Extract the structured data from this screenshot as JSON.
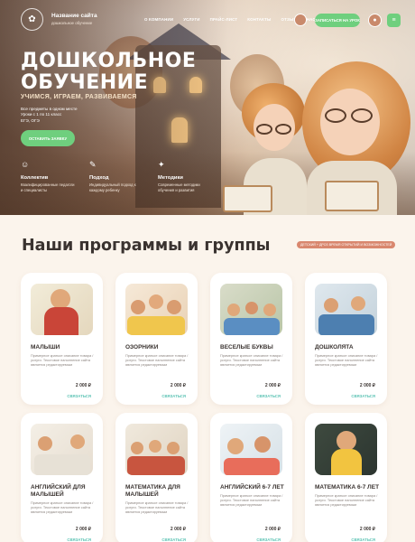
{
  "header": {
    "site_name": "Название сайта",
    "site_sub": "дошкольное обучение",
    "nav": [
      "О КОМПАНИИ",
      "УСЛУГИ",
      "ПРАЙС-ЛИСТ",
      "КОНТАКТЫ",
      "ОТЗЫВЫ О НАС"
    ],
    "contact_button": "ЗАПИСАТЬСЯ НА УРОК"
  },
  "hero": {
    "title_line1": "ДОШКОЛЬНОЕ",
    "title_line2": "ОБУЧЕНИЕ",
    "tagline": "УЧИМСЯ, ИГРАЕМ, РАЗВИВАЕМСЯ",
    "desc_line1": "Все предметы в одном месте",
    "desc_line2": "Уроки с 1 по 11 класс",
    "desc_line3": "ЕГЭ, ОГЭ",
    "cta": "ОСТАВИТЬ ЗАЯВКУ"
  },
  "features": [
    {
      "title": "Коллектив",
      "icon": "person-icon",
      "desc": "Квалифицированные педагоги и специалисты"
    },
    {
      "title": "Подход",
      "icon": "book-icon",
      "desc": "Индивидуальный подход к каждому ребенку"
    },
    {
      "title": "Методики",
      "icon": "method-icon",
      "desc": "Современные методики обучения и развития"
    }
  ],
  "section": {
    "title": "Наши программы и группы",
    "badge": "ДЕТСКИЙ + ДРОЗ ВРЕМЯ ОТКРЫТИЙ И ВОЗМОЖНОСТЕЙ"
  },
  "cards": [
    {
      "name": "МАЛЫШИ",
      "desc": "Примерное краткое описание товара / услуги. Текстовое наполнение сайта является редактируемым",
      "price": "2 000 ₽",
      "link": "СВЯЗАТЬСЯ"
    },
    {
      "name": "ОЗОРНИКИ",
      "desc": "Примерное краткое описание товара / услуги. Текстовое наполнение сайта является редактируемым",
      "price": "2 000 ₽",
      "link": "СВЯЗАТЬСЯ"
    },
    {
      "name": "ВЕСЕЛЫЕ БУКВЫ",
      "desc": "Примерное краткое описание товара / услуги. Текстовое наполнение сайта является редактируемым",
      "price": "2 000 ₽",
      "link": "СВЯЗАТЬСЯ"
    },
    {
      "name": "ДОШКОЛЯТА",
      "desc": "Примерное краткое описание товара / услуги. Текстовое наполнение сайта является редактируемым",
      "price": "2 000 ₽",
      "link": "СВЯЗАТЬСЯ"
    },
    {
      "name": "АНГЛИЙСКИЙ ДЛЯ МАЛЫШЕЙ",
      "desc": "Примерное краткое описание товара / услуги. Текстовое наполнение сайта является редактируемым",
      "price": "2 000 ₽",
      "link": "СВЯЗАТЬСЯ"
    },
    {
      "name": "МАТЕМАТИКА ДЛЯ МАЛЫШЕЙ",
      "desc": "Примерное краткое описание товара / услуги. Текстовое наполнение сайта является редактируемым",
      "price": "2 000 ₽",
      "link": "СВЯЗАТЬСЯ"
    },
    {
      "name": "АНГЛИЙСКИЙ 6-7 ЛЕТ",
      "desc": "Примерное краткое описание товара / услуги. Текстовое наполнение сайта является редактируемым",
      "price": "2 000 ₽",
      "link": "СВЯЗАТЬСЯ"
    },
    {
      "name": "МАТЕМАТИКА 6-7 ЛЕТ",
      "desc": "Примерное краткое описание товара / услуги. Текстовое наполнение сайта является редактируемым",
      "price": "2 000 ₽",
      "link": "СВЯЗАТЬСЯ"
    }
  ],
  "colors": {
    "accent_green": "#6fcf7e",
    "link_teal": "#5cc3b4",
    "badge": "#d9876e",
    "bg": "#fbf4ec"
  }
}
